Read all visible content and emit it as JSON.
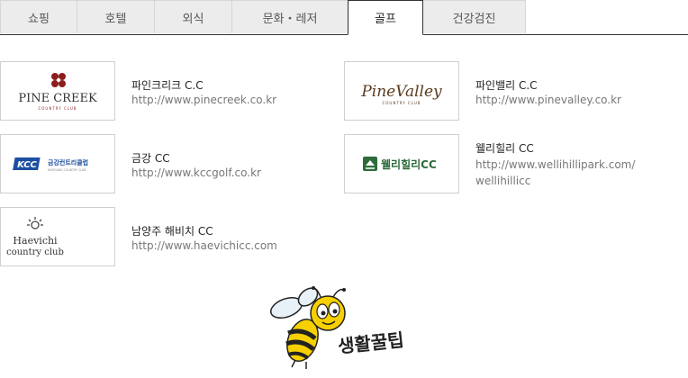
{
  "tabs": [
    {
      "label": "쇼핑",
      "active": false
    },
    {
      "label": "호텔",
      "active": false
    },
    {
      "label": "외식",
      "active": false
    },
    {
      "label": "문화・레저",
      "active": false
    },
    {
      "label": "골프",
      "active": true
    },
    {
      "label": "건강검진",
      "active": false
    }
  ],
  "clubs": [
    {
      "name": "파인크리크 C.C",
      "url": "http://www.pinecreek.co.kr",
      "logo_text": "PINE CREEK",
      "logo_sub": "COUNTRY CLUB"
    },
    {
      "name": "파인밸리 C.C",
      "url": "http://www.pinevalley.co.kr",
      "logo_text": "PineValley",
      "logo_sub": "COUNTRY CLUB"
    },
    {
      "name": "금강 CC",
      "url": "http://www.kccgolf.co.kr",
      "logo_text": "KCC",
      "logo_sub": "금강컨트리클럽",
      "logo_sub2": "KUMGANG COUNTRY CLUB"
    },
    {
      "name": "웰리힐리 CC",
      "url_line1": "http://www.wellihillipark.com/",
      "url_line2": "wellihillicc",
      "logo_text": "웰리힐리CC"
    },
    {
      "name": "남양주 해비치 CC",
      "url": "http://www.haevichicc.com",
      "logo_text": "Haevichi",
      "logo_sub": "country club"
    }
  ],
  "mascot": {
    "caption": "생활꿀팁"
  },
  "colors": {
    "tab_bg": "#ececec",
    "border": "#333333",
    "pine_creek_red": "#8b1d1d",
    "kcc_blue": "#1d4fa0",
    "welli_green": "#2e6b3a",
    "pine_valley_brown": "#5a3a1e",
    "bee_yellow": "#f6d000"
  }
}
